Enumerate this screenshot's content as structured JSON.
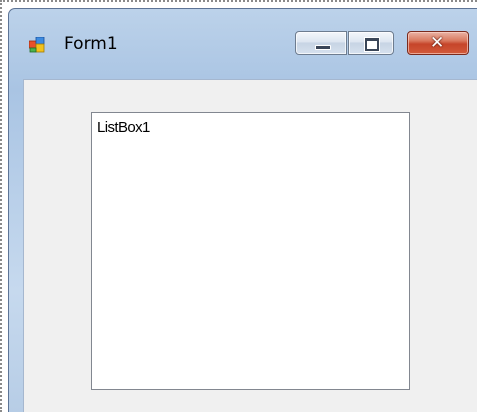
{
  "window": {
    "title": "Form1",
    "icon": "windows-form-icon",
    "controls": {
      "minimize_icon": "minimize-icon",
      "maximize_icon": "maximize-icon",
      "close_icon": "close-icon",
      "close_glyph": "✕"
    }
  },
  "form": {
    "listbox": {
      "items": [
        "ListBox1"
      ]
    }
  },
  "colors": {
    "close_button": "#c6452a",
    "client_background": "#f0f0f0",
    "titlebar": "#b8cfe9"
  }
}
